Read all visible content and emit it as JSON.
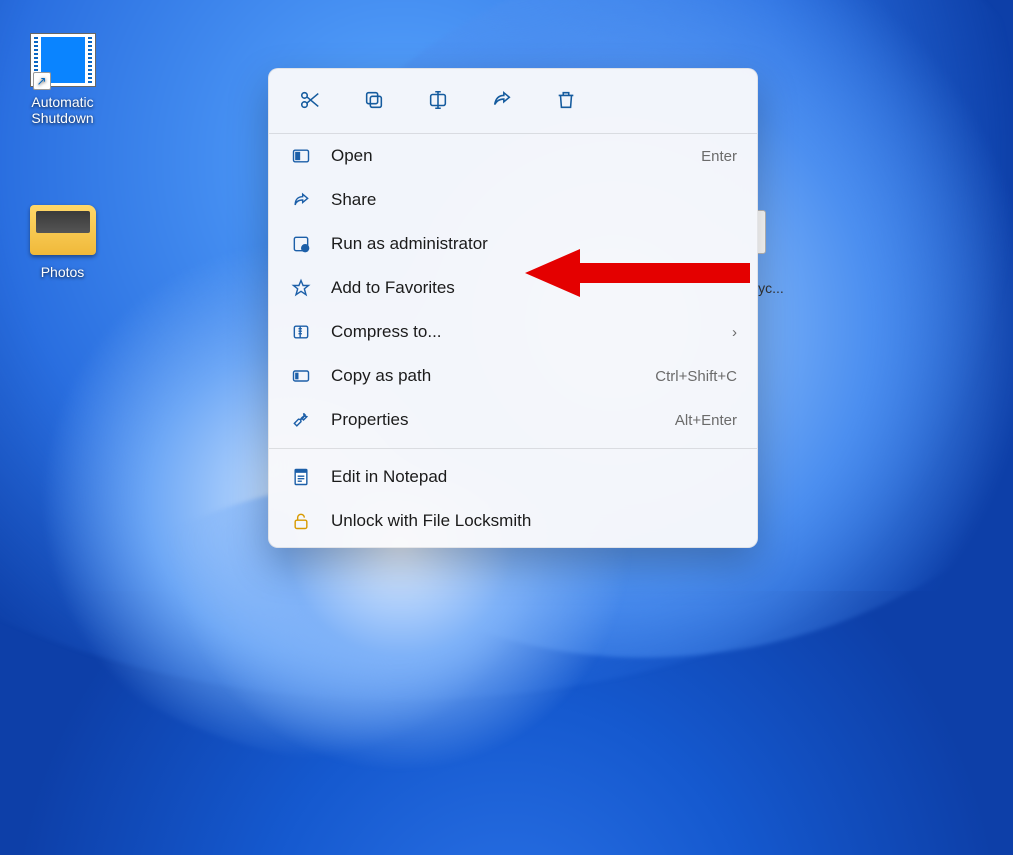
{
  "desktop": {
    "icons": [
      {
        "label": "Automatic Shutdown"
      },
      {
        "label": "Photos"
      }
    ],
    "partial_icon_label": "yc..."
  },
  "context_menu": {
    "top_actions": [
      {
        "name": "cut"
      },
      {
        "name": "copy"
      },
      {
        "name": "rename"
      },
      {
        "name": "share"
      },
      {
        "name": "delete"
      }
    ],
    "items": [
      {
        "label": "Open",
        "accel": "Enter"
      },
      {
        "label": "Share",
        "accel": ""
      },
      {
        "label": "Run as administrator",
        "accel": ""
      },
      {
        "label": "Add to Favorites",
        "accel": ""
      },
      {
        "label": "Compress to...",
        "accel": "",
        "submenu": true
      },
      {
        "label": "Copy as path",
        "accel": "Ctrl+Shift+C"
      },
      {
        "label": "Properties",
        "accel": "Alt+Enter"
      }
    ],
    "extra_items": [
      {
        "label": "Edit in Notepad"
      },
      {
        "label": "Unlock with File Locksmith"
      }
    ]
  },
  "annotation": {
    "targets": "Run as administrator"
  }
}
